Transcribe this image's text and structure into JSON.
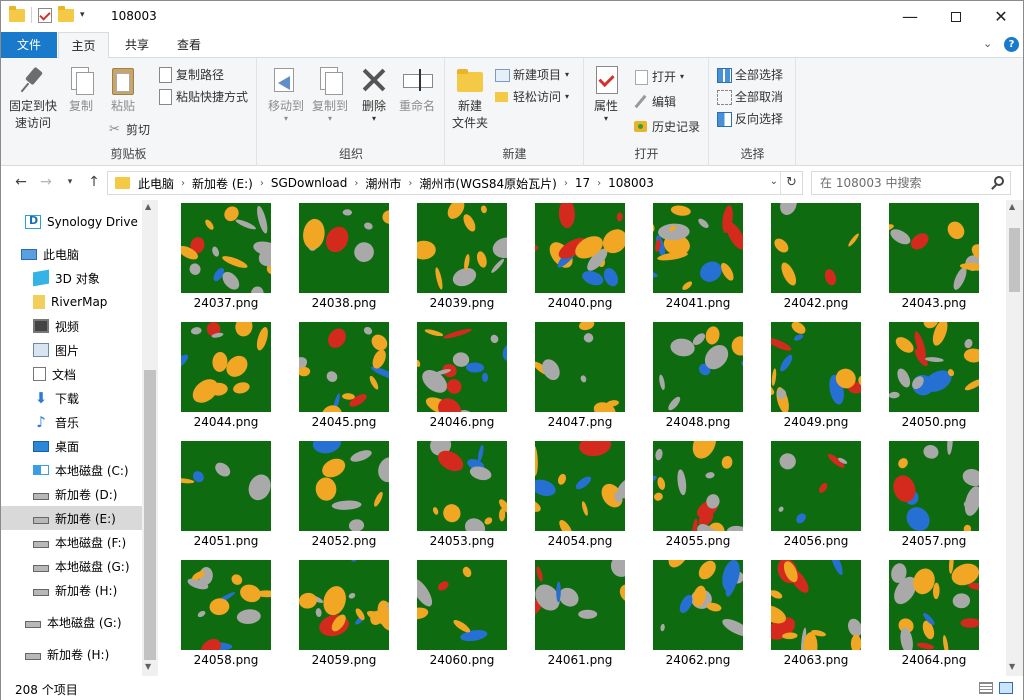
{
  "window": {
    "title": "108003",
    "minimize": "—",
    "close": "✕"
  },
  "ribbon": {
    "tabs": [
      "文件",
      "主页",
      "共享",
      "查看"
    ],
    "groups": {
      "clipboard": {
        "label": "剪贴板",
        "pin_line1": "固定到快",
        "pin_line2": "速访问",
        "copy": "复制",
        "paste": "粘贴",
        "copy_path": "复制路径",
        "paste_shortcut": "粘贴快捷方式",
        "cut": "剪切"
      },
      "organize": {
        "label": "组织",
        "move_to": "移动到",
        "copy_to": "复制到",
        "delete": "删除",
        "rename": "重命名"
      },
      "new": {
        "label": "新建",
        "new_folder_line1": "新建",
        "new_folder_line2": "文件夹",
        "new_item": "新建项目",
        "easy_access": "轻松访问"
      },
      "open": {
        "label": "打开",
        "properties": "属性",
        "open": "打开",
        "edit": "编辑",
        "history": "历史记录"
      },
      "select": {
        "label": "选择",
        "select_all": "全部选择",
        "select_none": "全部取消",
        "invert": "反向选择"
      }
    }
  },
  "address": {
    "crumbs": [
      "此电脑",
      "新加卷 (E:)",
      "SGDownload",
      "潮州市",
      "潮州市(WGS84原始瓦片)",
      "17",
      "108003"
    ],
    "search_placeholder": "在 108003 中搜索"
  },
  "nav": {
    "items": [
      {
        "label": "Synology Drive ·",
        "icon": "synology-drive-icon"
      },
      {
        "label": "此电脑",
        "icon": "this-pc-icon"
      },
      {
        "label": "3D 对象",
        "icon": "3d-objects-icon"
      },
      {
        "label": "RiverMap",
        "icon": "file-icon"
      },
      {
        "label": "视频",
        "icon": "video-icon"
      },
      {
        "label": "图片",
        "icon": "pictures-icon"
      },
      {
        "label": "文档",
        "icon": "documents-icon"
      },
      {
        "label": "下载",
        "icon": "download-icon"
      },
      {
        "label": "音乐",
        "icon": "music-icon"
      },
      {
        "label": "桌面",
        "icon": "desktop-icon"
      },
      {
        "label": "本地磁盘 (C:)",
        "icon": "windows-drive-icon"
      },
      {
        "label": "新加卷 (D:)",
        "icon": "drive-icon"
      },
      {
        "label": "新加卷 (E:)",
        "icon": "drive-icon",
        "selected": true
      },
      {
        "label": "本地磁盘 (F:)",
        "icon": "drive-icon"
      },
      {
        "label": "本地磁盘 (G:)",
        "icon": "drive-icon"
      },
      {
        "label": "新加卷 (H:)",
        "icon": "drive-icon"
      },
      {
        "label": "本地磁盘 (G:)",
        "icon": "drive-icon"
      },
      {
        "label": "新加卷 (H:)",
        "icon": "drive-icon"
      }
    ]
  },
  "files": [
    "24037.png",
    "24038.png",
    "24039.png",
    "24040.png",
    "24041.png",
    "24042.png",
    "24043.png",
    "24044.png",
    "24045.png",
    "24046.png",
    "24047.png",
    "24048.png",
    "24049.png",
    "24050.png",
    "24051.png",
    "24052.png",
    "24053.png",
    "24054.png",
    "24055.png",
    "24056.png",
    "24057.png",
    "24058.png",
    "24059.png",
    "24060.png",
    "24061.png",
    "24062.png",
    "24063.png",
    "24064.png"
  ],
  "status": {
    "count": "208 个项目"
  },
  "colors": {
    "accent": "#1979ca",
    "land_green": "#0f6b0f",
    "orange": "#f2a724",
    "water_blue": "#2670d4",
    "gray": "#a9a9a9",
    "red": "#d42a1e"
  }
}
